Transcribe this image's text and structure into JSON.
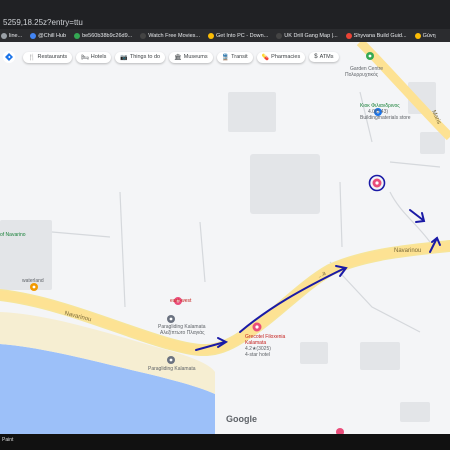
{
  "browser": {
    "url": "5259,18.25z?entry=ttu",
    "bookmarks": [
      {
        "label": "line...",
        "color": "#9aa0a6"
      },
      {
        "label": "@Chill Hub",
        "color": "#4285f4"
      },
      {
        "label": "be560b38b9c26d9...",
        "color": "#34a853"
      },
      {
        "label": "Watch Free Movies...",
        "color": "#202124"
      },
      {
        "label": "Get Into PC - Down...",
        "color": "#fbbc04"
      },
      {
        "label": "UK Drill Gang Map |...",
        "color": "#202124"
      },
      {
        "label": "Shyvana Build Guid...",
        "color": "#ea4335"
      },
      {
        "label": "Gùvη",
        "color": "#fbbc04"
      }
    ]
  },
  "maps": {
    "logo_icon": "google-maps-diamond-icon",
    "chips": [
      {
        "label": "Restaurants",
        "icon": "fork-knife-icon",
        "glyph": "🍴"
      },
      {
        "label": "Hotels",
        "icon": "bed-icon",
        "glyph": "🛏"
      },
      {
        "label": "Things to do",
        "icon": "camera-icon",
        "glyph": "📷"
      },
      {
        "label": "Museums",
        "icon": "museum-icon",
        "glyph": "🏛"
      },
      {
        "label": "Transit",
        "icon": "train-icon",
        "glyph": "🚆"
      },
      {
        "label": "Pharmacies",
        "icon": "pharmacy-icon",
        "glyph": "💊"
      },
      {
        "label": "ATMs",
        "icon": "atm-icon",
        "glyph": "$"
      }
    ],
    "places": {
      "garden_centre_1": "Garden Centre",
      "garden_centre_2": "Πολυρρυχτικός",
      "kiosk_1": "Κιοκ Φιλιανδρινος",
      "kiosk_2": "4.0(5 43)",
      "kiosk_3": "Buildingmaterials store",
      "of_navarino": "of Navarino",
      "waterland": "waterland",
      "east_west": "east-west",
      "paragliding_1": "Paragliding Kalamata",
      "paragliding_2": "Αλεξίπτωτο Πλαγιάς",
      "grecotel_1": "Grecotel Filoxenia",
      "grecotel_2": "Kalamata",
      "grecotel_3": "4.2★(3025)",
      "grecotel_4": "4-star hotel",
      "paragliding_beach": "Paragliding Kalamata"
    },
    "roads": {
      "navarinou_left": "Navarinou",
      "navarinou_right": "Navarinou",
      "marts": "Maris",
      "road_mid": "...a"
    },
    "google_logo": "Google",
    "annotations_color": "#1a1aa6"
  },
  "taskbar": {
    "label": "Paint"
  }
}
